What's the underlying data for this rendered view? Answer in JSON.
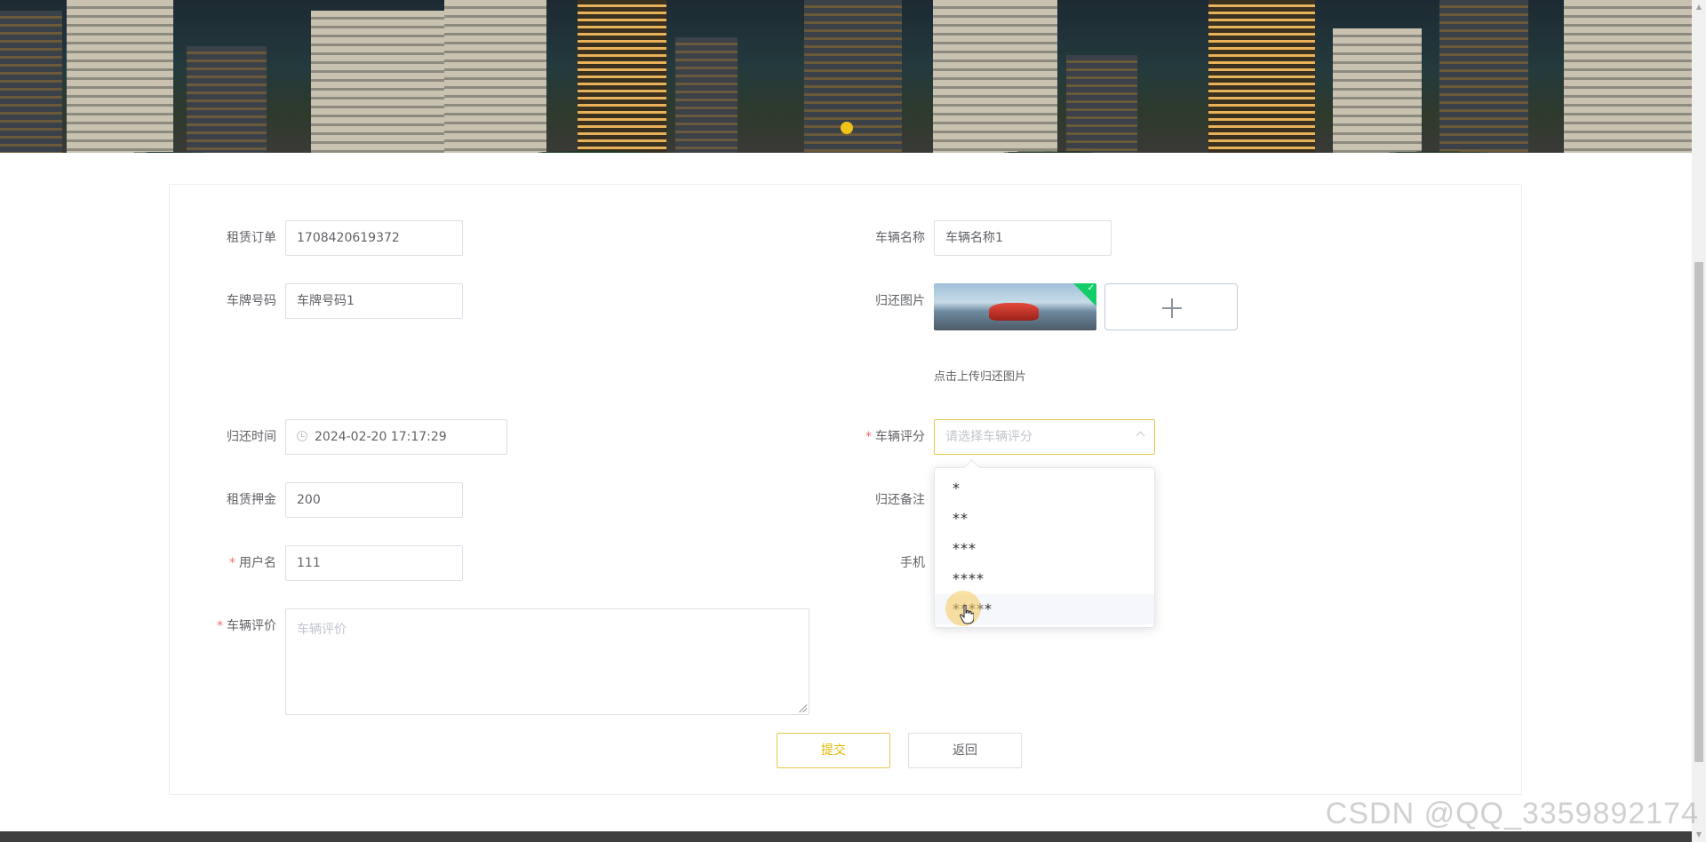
{
  "form": {
    "order": {
      "label": "租赁订单",
      "value": "1708420619372"
    },
    "vehicle_name": {
      "label": "车辆名称",
      "value": "车辆名称1"
    },
    "plate": {
      "label": "车牌号码",
      "value": "车牌号码1"
    },
    "return_image": {
      "label": "归还图片",
      "tip": "点击上传归还图片"
    },
    "return_time": {
      "label": "归还时间",
      "value": "2024-02-20 17:17:29"
    },
    "rating": {
      "label": "车辆评分",
      "placeholder": "请选择车辆评分",
      "required": "*"
    },
    "deposit": {
      "label": "租赁押金",
      "value": "200"
    },
    "return_note": {
      "label": "归还备注"
    },
    "username": {
      "label": "用户名",
      "value": "111",
      "required": "*"
    },
    "phone": {
      "label": "手机"
    },
    "review": {
      "label": "车辆评价",
      "placeholder": "车辆评价",
      "required": "*"
    }
  },
  "rating_options": [
    "*",
    "**",
    "***",
    "****",
    "*****"
  ],
  "buttons": {
    "submit": "提交",
    "back": "返回"
  },
  "watermark": "CSDN @QQ_3359892174",
  "colors": {
    "accent": "#e6b800",
    "required": "#f56c6c",
    "upload_success": "#13ce66"
  }
}
